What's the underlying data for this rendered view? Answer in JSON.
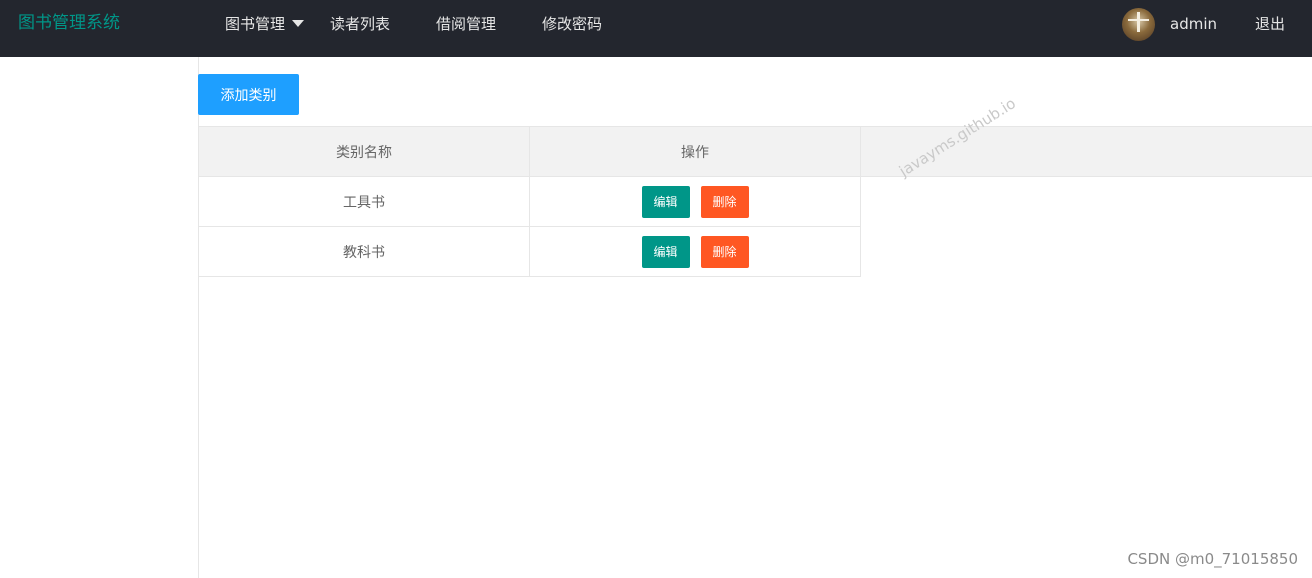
{
  "header": {
    "logo": "图书管理系统",
    "nav": [
      {
        "label": "图书管理"
      },
      {
        "label": "读者列表"
      },
      {
        "label": "借阅管理"
      },
      {
        "label": "修改密码"
      }
    ],
    "username": "admin",
    "logout": "退出"
  },
  "toolbar": {
    "add_label": "添加类别"
  },
  "table": {
    "columns": [
      "类别名称",
      "操作"
    ],
    "rows": [
      {
        "name": "工具书",
        "edit": "编辑",
        "delete": "删除"
      },
      {
        "name": "教科书",
        "edit": "编辑",
        "delete": "删除"
      }
    ]
  },
  "watermark": "javayms.github.io",
  "footer_mark": "CSDN @m0_71015850",
  "colors": {
    "topbar": "#23262e",
    "logo": "#009688",
    "primary": "#1e9fff",
    "edit": "#009688",
    "delete": "#ff5722"
  }
}
